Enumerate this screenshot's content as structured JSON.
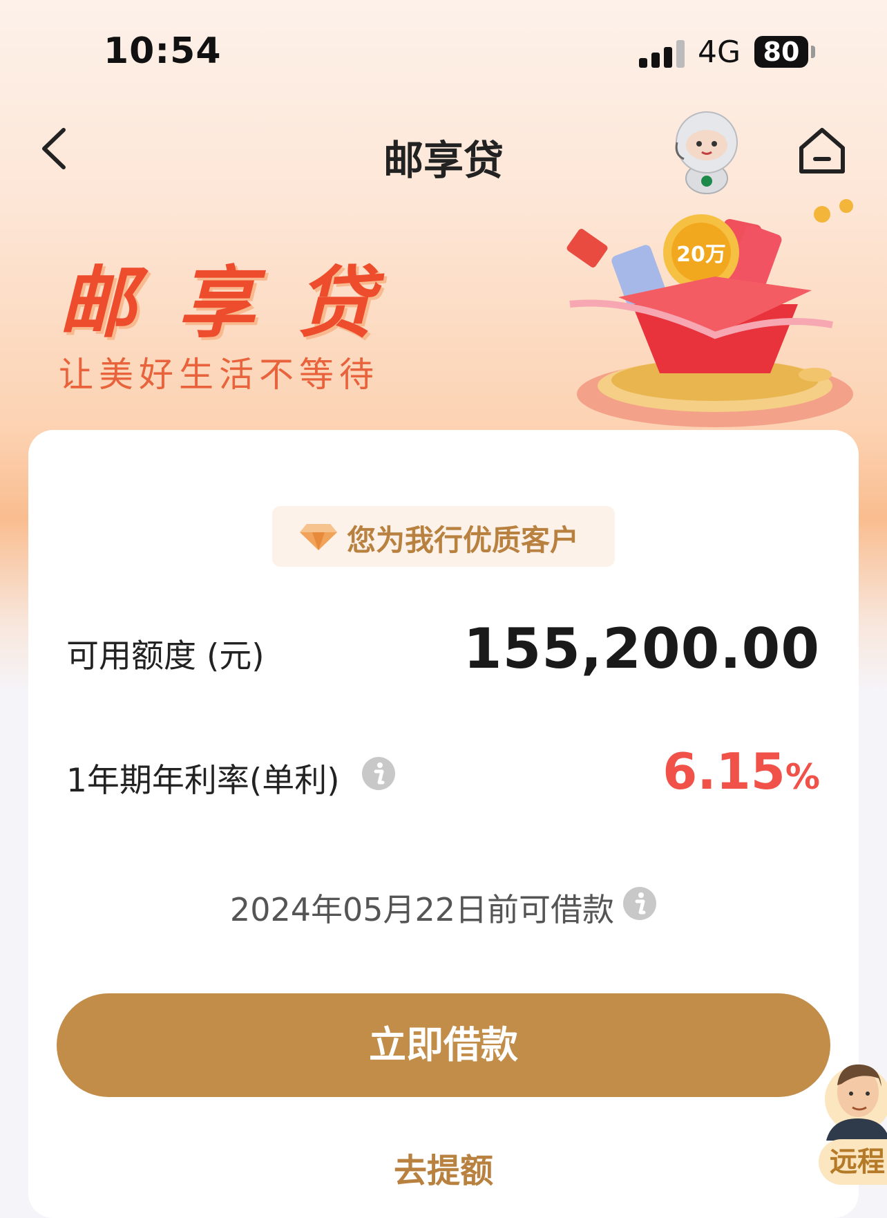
{
  "status_bar": {
    "time": "10:54",
    "network": "4G",
    "battery": "80"
  },
  "nav": {
    "title": "邮享贷"
  },
  "banner": {
    "title": "邮享贷",
    "subtitle": "让美好生活不等待",
    "prize_label": "20万"
  },
  "card": {
    "badge": "您为我行优质客户",
    "limit_label": "可用额度 (元)",
    "limit_value": "155,200.00",
    "rate_label": "1年期年利率(单利)",
    "rate_value": "6.15",
    "rate_unit": "%",
    "deadline_text": "2024年05月22日前可借款",
    "borrow_button": "立即借款",
    "raise_link": "去提额"
  },
  "assistant": {
    "label": "远程"
  },
  "colors": {
    "accent": "#c18d48",
    "rate_red": "#f0524a",
    "banner_red": "#ee4d2d"
  }
}
